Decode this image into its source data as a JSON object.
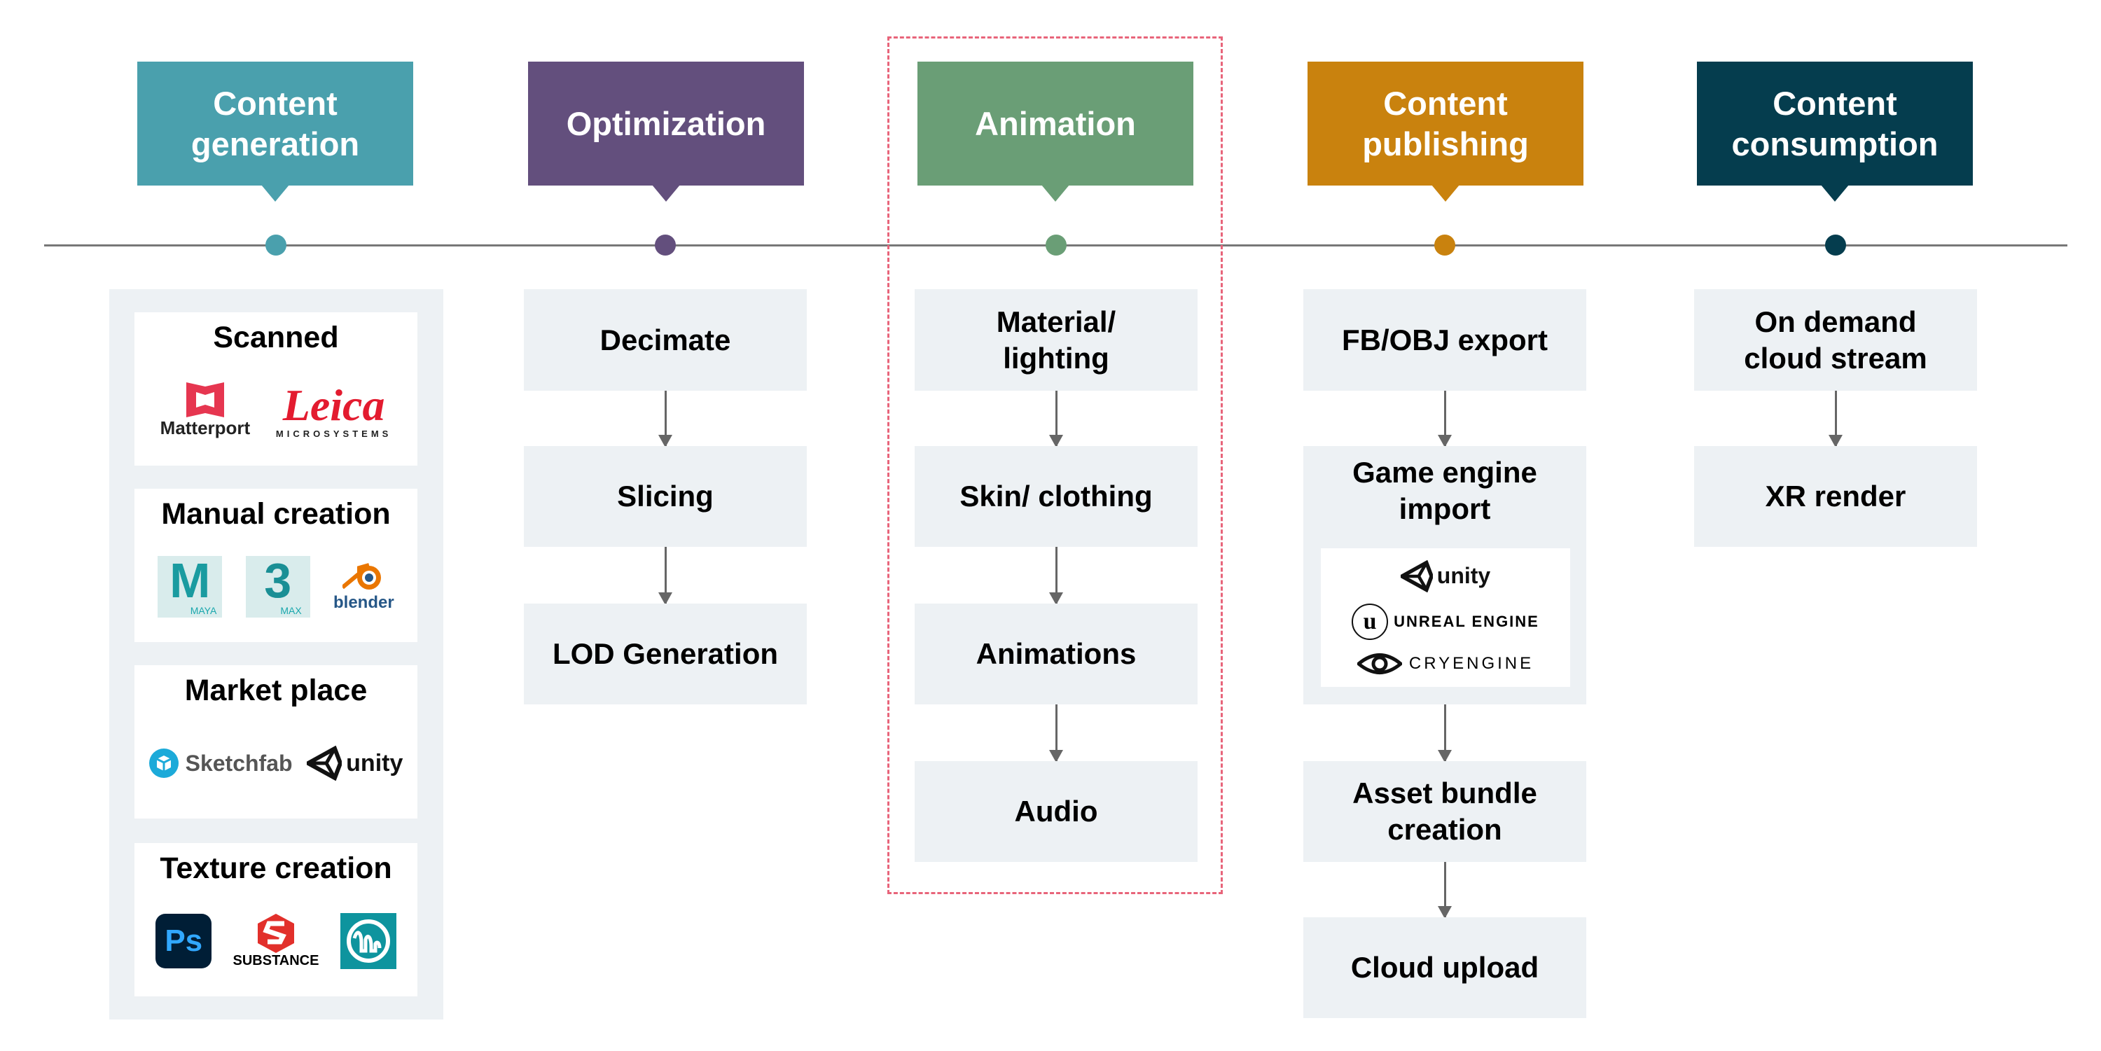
{
  "stages": [
    {
      "title": "Content generation",
      "color": "#4aa0ad"
    },
    {
      "title": "Optimization",
      "color": "#634f7d"
    },
    {
      "title": "Animation",
      "color": "#6a9e76"
    },
    {
      "title": "Content publishing",
      "color": "#c9820e"
    },
    {
      "title": "Content consumption",
      "color": "#053d4e"
    }
  ],
  "content_generation": {
    "cards": [
      {
        "title": "Scanned",
        "logos": [
          "Matterport",
          "Leica",
          "MICROSYSTEMS"
        ]
      },
      {
        "title": "Manual creation",
        "logos": [
          "MAYA",
          "MAX",
          "blender"
        ]
      },
      {
        "title": "Market place",
        "logos": [
          "Sketchfab",
          "unity"
        ]
      },
      {
        "title": "Texture creation",
        "logos": [
          "Ps",
          "SUBSTANCE"
        ]
      }
    ]
  },
  "optimization": {
    "steps": [
      "Decimate",
      "Slicing",
      "LOD Generation"
    ]
  },
  "animation": {
    "steps": [
      "Material/ lighting",
      "Skin/ clothing",
      "Animations",
      "Audio"
    ],
    "highlight_color": "#e8647a"
  },
  "publishing": {
    "steps": [
      "FB/OBJ export",
      "Game engine import",
      "Asset bundle creation",
      "Cloud upload"
    ],
    "engines": [
      "unity",
      "UNREAL ENGINE",
      "CRYENGINE"
    ]
  },
  "consumption": {
    "steps": [
      "On demand cloud stream",
      "XR render"
    ]
  }
}
